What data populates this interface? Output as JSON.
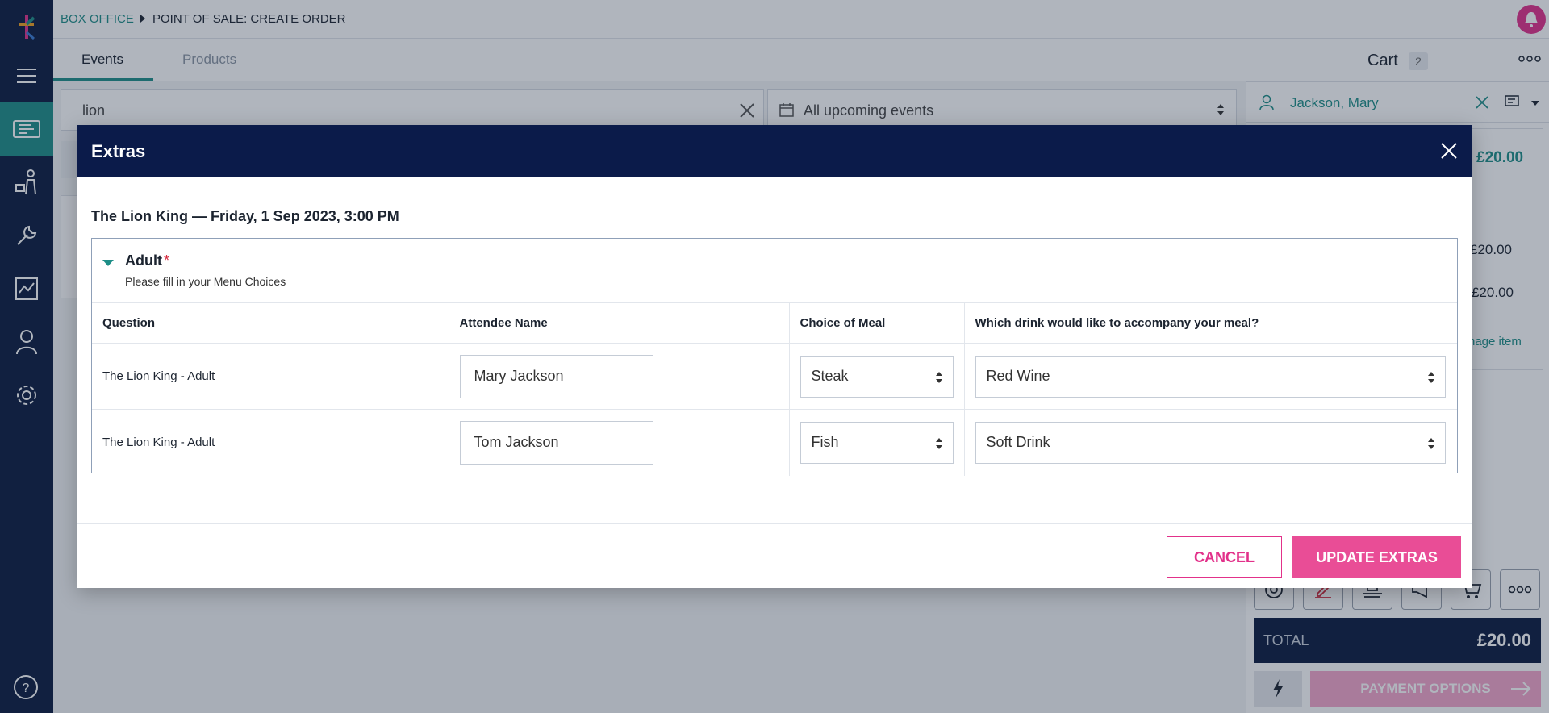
{
  "breadcrumb": {
    "section": "BOX OFFICE",
    "page": "POINT OF SALE: CREATE ORDER"
  },
  "tabs": [
    {
      "label": "Events"
    },
    {
      "label": "Products"
    }
  ],
  "search": {
    "value": "lion"
  },
  "filter": {
    "value": "All upcoming events"
  },
  "cart": {
    "title": "Cart",
    "count": "2",
    "customer": "Jackson, Mary",
    "price_top": "£20.00",
    "line1": "£20.00",
    "line2": "£20.00",
    "manage_link": "nage item",
    "total_label": "TOTAL",
    "total_value": "£20.00",
    "payment_label": "PAYMENT OPTIONS"
  },
  "modal": {
    "title": "Extras",
    "event": "The Lion King — Friday, 1 Sep 2023, 3:00 PM",
    "section_label": "Adult",
    "required_mark": "*",
    "section_hint": "Please fill in your Menu Choices",
    "columns": [
      "Question",
      "Attendee Name",
      "Choice of Meal",
      "Which drink would like to accompany your meal?"
    ],
    "rows": [
      {
        "question": "The Lion King - Adult",
        "attendee": "Mary Jackson",
        "meal": "Steak",
        "drink": "Red Wine"
      },
      {
        "question": "The Lion King - Adult",
        "attendee": "Tom Jackson",
        "meal": "Fish",
        "drink": "Soft Drink"
      }
    ],
    "cancel_label": "CANCEL",
    "update_label": "UPDATE EXTRAS"
  },
  "colors": {
    "sidebar": "#0b1b3f",
    "accent_teal": "#1e8e87",
    "accent_pink": "#e2318a",
    "modal_header": "#0b1b4a"
  },
  "icons": [
    "logo-icon",
    "menu-icon",
    "ticket-icon",
    "customer-service-icon",
    "wrench-icon",
    "reports-icon",
    "user-icon",
    "settings-icon",
    "help-icon",
    "bell-icon",
    "close-icon",
    "calendar-icon",
    "sort-arrows-icon",
    "more-icon"
  ]
}
